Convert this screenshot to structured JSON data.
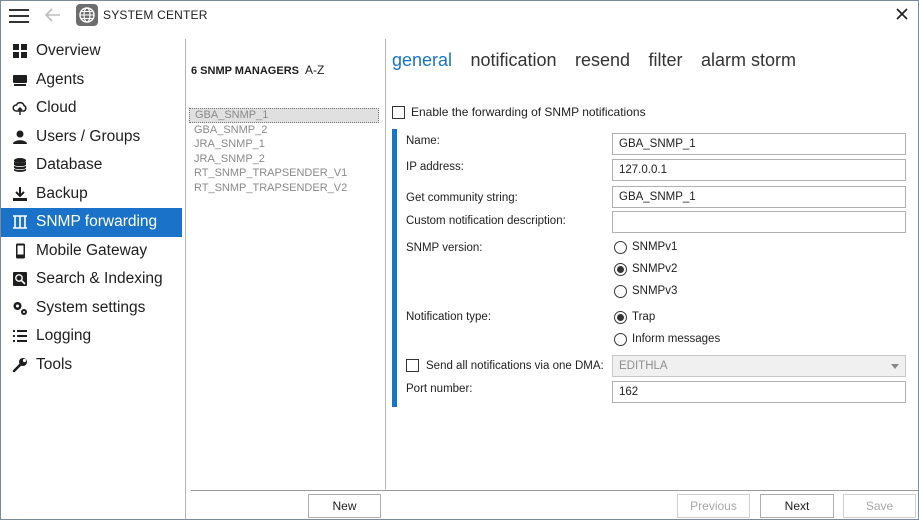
{
  "window": {
    "title": "SYSTEM CENTER"
  },
  "sidebar": {
    "items": [
      {
        "label": "Overview",
        "icon": "dashboard-icon"
      },
      {
        "label": "Agents",
        "icon": "agents-icon"
      },
      {
        "label": "Cloud",
        "icon": "cloud-icon"
      },
      {
        "label": "Users / Groups",
        "icon": "user-icon"
      },
      {
        "label": "Database",
        "icon": "database-icon"
      },
      {
        "label": "Backup",
        "icon": "download-icon"
      },
      {
        "label": "SNMP forwarding",
        "icon": "snmp-icon",
        "active": true
      },
      {
        "label": "Mobile Gateway",
        "icon": "mobile-icon"
      },
      {
        "label": "Search & Indexing",
        "icon": "search-indexing-icon"
      },
      {
        "label": "System settings",
        "icon": "gears-icon"
      },
      {
        "label": "Logging",
        "icon": "list-icon"
      },
      {
        "label": "Tools",
        "icon": "wrench-icon"
      }
    ]
  },
  "managers": {
    "header": "6 SNMP MANAGERS",
    "sort": "A-Z",
    "items": [
      "GBA_SNMP_1",
      "GBA_SNMP_2",
      "JRA_SNMP_1",
      "JRA_SNMP_2",
      "RT_SNMP_TRAPSENDER_V1",
      "RT_SNMP_TRAPSENDER_V2"
    ],
    "selected": "GBA_SNMP_1"
  },
  "tabs": [
    "general",
    "notification",
    "resend",
    "filter",
    "alarm storm"
  ],
  "active_tab": "general",
  "form": {
    "enable_forwarding": {
      "label": "Enable the forwarding of SNMP notifications",
      "checked": false
    },
    "name": {
      "label": "Name:",
      "value": "GBA_SNMP_1"
    },
    "ip": {
      "label": "IP address:",
      "value": "127.0.0.1"
    },
    "community": {
      "label": "Get community string:",
      "value": "GBA_SNMP_1"
    },
    "custom_desc": {
      "label": "Custom notification description:",
      "value": ""
    },
    "snmp_version": {
      "label": "SNMP version:",
      "options": [
        "SNMPv1",
        "SNMPv2",
        "SNMPv3"
      ],
      "selected": "SNMPv2"
    },
    "notification_type": {
      "label": "Notification type:",
      "options": [
        "Trap",
        "Inform messages"
      ],
      "selected": "Trap"
    },
    "dma": {
      "label": "Send all notifications via one DMA:",
      "checked": false,
      "value": "EDITHLA"
    },
    "port": {
      "label": "Port number:",
      "value": "162"
    }
  },
  "buttons": {
    "new": "New",
    "previous": "Previous",
    "next": "Next",
    "save": "Save"
  },
  "colors": {
    "accent": "#1a73c8"
  }
}
